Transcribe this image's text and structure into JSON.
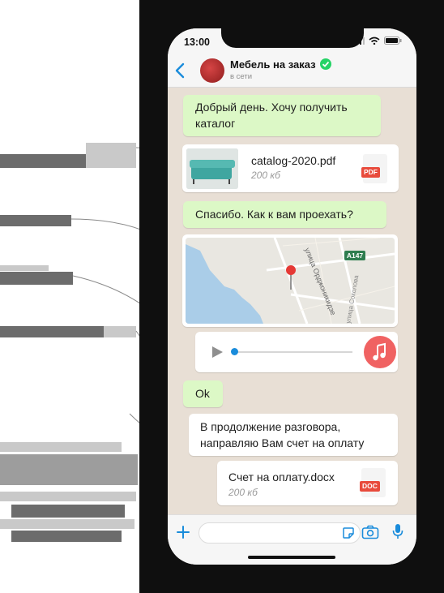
{
  "statusbar": {
    "time": "13:00"
  },
  "header": {
    "title": "Мебель на заказ",
    "status": "в сети"
  },
  "messages": {
    "m1": {
      "text": "Добрый день. Хочу получить каталог"
    },
    "m2": {
      "file_name": "catalog-2020.pdf",
      "file_size": "200 кб",
      "badge": "PDF"
    },
    "m3": {
      "text": "Спасибо. Как к вам проехать?"
    },
    "m4": {
      "labels": {
        "street1": "улица Орджоникидзе",
        "road": "A147",
        "street2": "улица Соколова"
      }
    },
    "m6": {
      "text": "Ok"
    },
    "m7": {
      "text": "В продолжение разговора, направляю Вам счет на оплату"
    },
    "m8": {
      "file_name": "Счет на оплату.docx",
      "file_size": "200 кб",
      "badge": "DOC"
    }
  },
  "colors": {
    "outgoing_bubble": "#dcf8c6",
    "incoming_bubble": "#ffffff",
    "accent_blue": "#1a8cdb",
    "pdf_badge": "#e84b3c",
    "doc_badge": "#e84b3c",
    "audio_button": "#f06262"
  },
  "icons": [
    "back-chevron-icon",
    "verified-icon",
    "location-icon",
    "play-icon",
    "music-note-icon",
    "plus-icon",
    "sticker-icon",
    "camera-icon",
    "microphone-icon"
  ]
}
